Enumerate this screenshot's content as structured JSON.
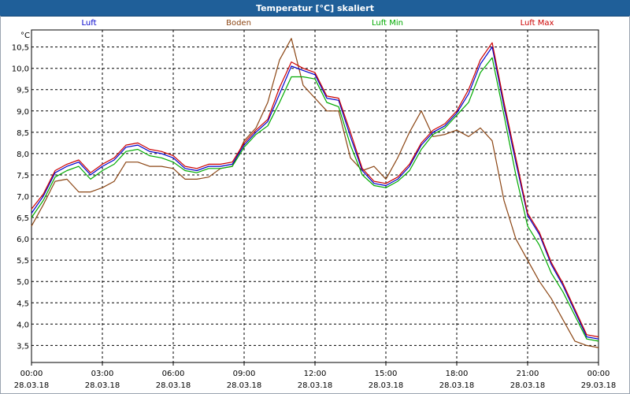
{
  "window": {
    "title": "Temperatur [°C] skaliert"
  },
  "chart_data": {
    "type": "line",
    "title": "Temperatur [°C] skaliert",
    "ylabel": "°C",
    "ylim": [
      3.1,
      10.9
    ],
    "yticks": [
      3.5,
      4.0,
      4.5,
      5.0,
      5.5,
      6.0,
      6.5,
      7.0,
      7.5,
      8.0,
      8.5,
      9.0,
      9.5,
      10.0,
      10.5
    ],
    "ytick_labels": [
      "3,5",
      "4,0",
      "4,5",
      "5,0",
      "5,5",
      "6,0",
      "6,5",
      "7,0",
      "7,5",
      "8,0",
      "8,5",
      "9,0",
      "9,5",
      "10,0",
      "10,5"
    ],
    "xlim": [
      0,
      24
    ],
    "xticks": [
      {
        "x": 0,
        "time": "00:00",
        "date": "28.03.18"
      },
      {
        "x": 3,
        "time": "03:00",
        "date": "28.03.18"
      },
      {
        "x": 6,
        "time": "06:00",
        "date": "28.03.18"
      },
      {
        "x": 9,
        "time": "09:00",
        "date": "28.03.18"
      },
      {
        "x": 12,
        "time": "12:00",
        "date": "28.03.18"
      },
      {
        "x": 15,
        "time": "15:00",
        "date": "28.03.18"
      },
      {
        "x": 18,
        "time": "18:00",
        "date": "28.03.18"
      },
      {
        "x": 21,
        "time": "21:00",
        "date": "28.03.18"
      },
      {
        "x": 24,
        "time": "00:00",
        "date": "29.03.18"
      }
    ],
    "grid": true,
    "legend_position": "top",
    "x": [
      0,
      0.5,
      1,
      1.5,
      2,
      2.5,
      3,
      3.5,
      4,
      4.5,
      5,
      5.5,
      6,
      6.5,
      7,
      7.5,
      8,
      8.5,
      9,
      9.5,
      10,
      10.5,
      11,
      11.5,
      12,
      12.5,
      13,
      13.5,
      14,
      14.5,
      15,
      15.5,
      16,
      16.5,
      17,
      17.5,
      18,
      18.5,
      19,
      19.5,
      20,
      20.5,
      21,
      21.5,
      22,
      22.5,
      23,
      23.5,
      24
    ],
    "series": [
      {
        "name": "Luft",
        "color": "#0000cc",
        "values": [
          6.6,
          7.0,
          7.55,
          7.7,
          7.8,
          7.5,
          7.7,
          7.85,
          8.15,
          8.2,
          8.05,
          8.0,
          7.9,
          7.65,
          7.6,
          7.7,
          7.7,
          7.75,
          8.2,
          8.5,
          8.75,
          9.4,
          10.05,
          9.95,
          9.85,
          9.3,
          9.25,
          8.4,
          7.6,
          7.3,
          7.25,
          7.4,
          7.7,
          8.2,
          8.5,
          8.65,
          8.95,
          9.4,
          10.1,
          10.5,
          9.1,
          7.8,
          6.55,
          6.1,
          5.4,
          4.9,
          4.3,
          3.7,
          3.65
        ]
      },
      {
        "name": "Boden",
        "color": "#8b4513",
        "values": [
          6.3,
          6.8,
          7.35,
          7.4,
          7.1,
          7.1,
          7.2,
          7.35,
          7.8,
          7.8,
          7.7,
          7.7,
          7.65,
          7.4,
          7.4,
          7.45,
          7.65,
          7.7,
          8.3,
          8.6,
          9.2,
          10.2,
          10.7,
          9.6,
          9.3,
          9.0,
          9.0,
          7.9,
          7.6,
          7.7,
          7.4,
          7.9,
          8.5,
          9.0,
          8.4,
          8.45,
          8.55,
          8.4,
          8.6,
          8.3,
          6.9,
          6.0,
          5.5,
          5.0,
          4.6,
          4.1,
          3.6,
          3.5,
          3.45
        ]
      },
      {
        "name": "Luft Min",
        "color": "#00aa00",
        "values": [
          6.5,
          6.9,
          7.45,
          7.6,
          7.7,
          7.4,
          7.6,
          7.75,
          8.05,
          8.1,
          7.95,
          7.9,
          7.8,
          7.6,
          7.55,
          7.65,
          7.65,
          7.7,
          8.15,
          8.45,
          8.65,
          9.2,
          9.8,
          9.8,
          9.75,
          9.2,
          9.1,
          8.2,
          7.5,
          7.25,
          7.2,
          7.35,
          7.6,
          8.1,
          8.45,
          8.6,
          8.9,
          9.2,
          9.9,
          10.25,
          8.9,
          7.5,
          6.3,
          5.85,
          5.2,
          4.75,
          4.2,
          3.65,
          3.6
        ]
      },
      {
        "name": "Luft Max",
        "color": "#cc0000",
        "values": [
          6.7,
          7.05,
          7.6,
          7.75,
          7.85,
          7.55,
          7.75,
          7.9,
          8.2,
          8.25,
          8.1,
          8.05,
          7.95,
          7.7,
          7.65,
          7.75,
          7.75,
          7.8,
          8.25,
          8.55,
          8.8,
          9.55,
          10.15,
          10.0,
          9.9,
          9.35,
          9.3,
          8.5,
          7.65,
          7.35,
          7.3,
          7.45,
          7.75,
          8.25,
          8.55,
          8.7,
          9.0,
          9.5,
          10.2,
          10.6,
          9.2,
          7.9,
          6.6,
          6.15,
          5.45,
          4.95,
          4.35,
          3.75,
          3.7
        ]
      }
    ]
  }
}
